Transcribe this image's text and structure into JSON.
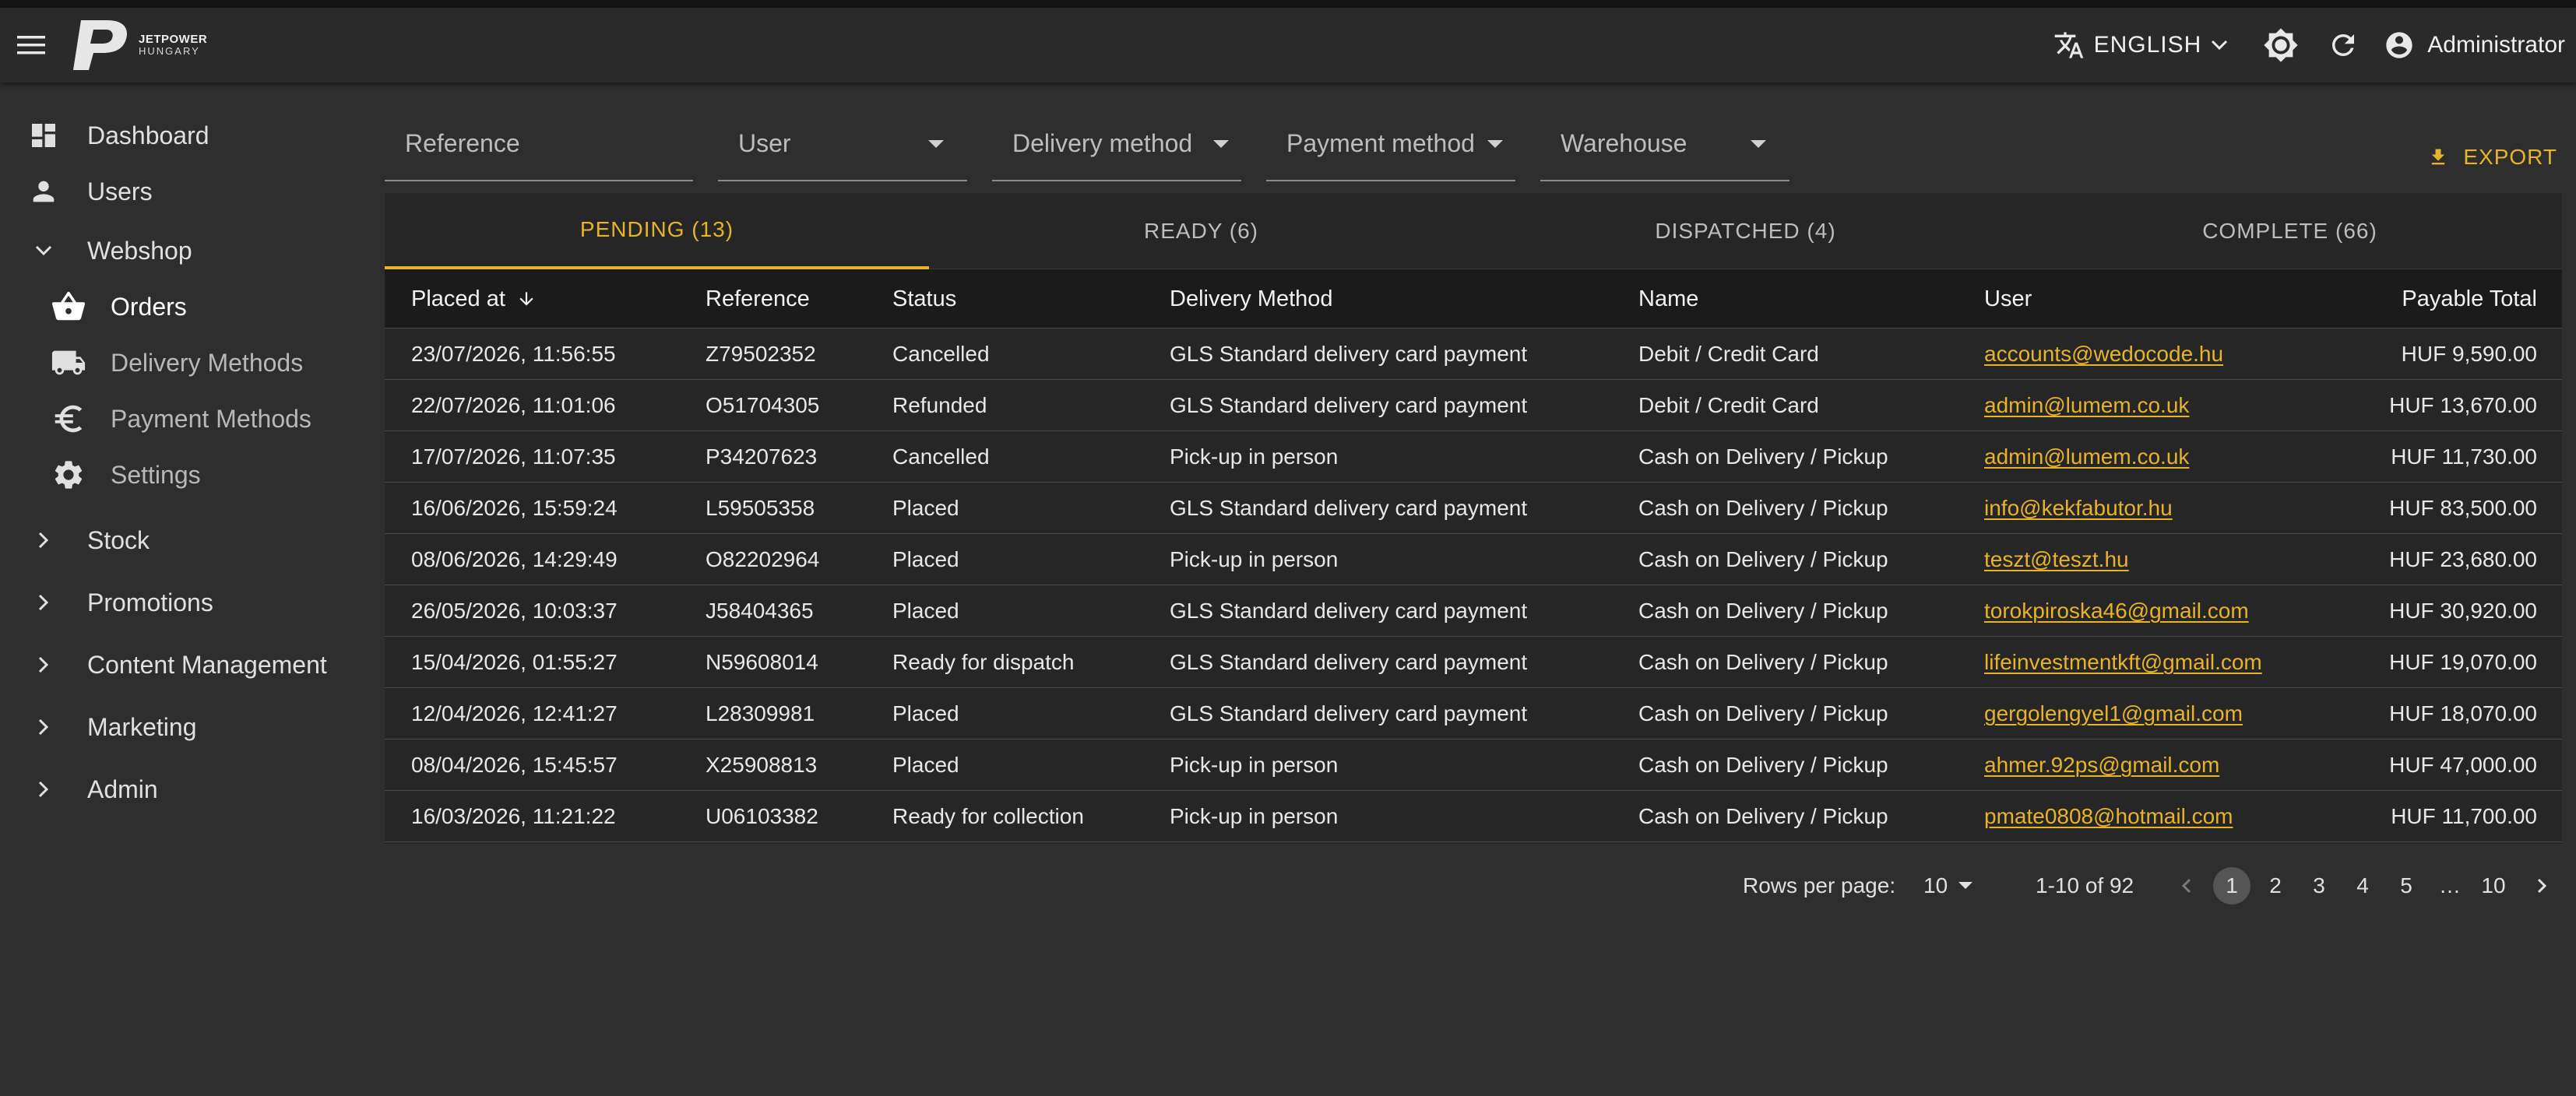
{
  "app": {
    "logo_line1": "JETPOWER",
    "logo_line2": "HUNGARY",
    "language": "ENGLISH",
    "user": "Administrator"
  },
  "sidebar": {
    "dashboard": "Dashboard",
    "users": "Users",
    "webshop": "Webshop",
    "orders": "Orders",
    "delivery_methods": "Delivery Methods",
    "payment_methods": "Payment Methods",
    "settings": "Settings",
    "stock": "Stock",
    "promotions": "Promotions",
    "content_management": "Content Management",
    "marketing": "Marketing",
    "admin": "Admin"
  },
  "filters": {
    "reference": "Reference",
    "user": "User",
    "delivery_method": "Delivery method",
    "payment_method": "Payment method",
    "warehouse": "Warehouse"
  },
  "export_label": "EXPORT",
  "tabs": [
    "PENDING (13)",
    "READY (6)",
    "DISPATCHED (4)",
    "COMPLETE (66)"
  ],
  "columns": {
    "placed_at": "Placed at",
    "reference": "Reference",
    "status": "Status",
    "delivery_method": "Delivery Method",
    "name": "Name",
    "user": "User",
    "payable_total": "Payable Total"
  },
  "rows": [
    {
      "placed_at": "23/07/2026, 11:56:55",
      "reference": "Z79502352",
      "status": "Cancelled",
      "delivery": "GLS Standard delivery card payment",
      "name": "Debit / Credit Card",
      "user": "accounts@wedocode.hu",
      "total": "HUF 9,590.00"
    },
    {
      "placed_at": "22/07/2026, 11:01:06",
      "reference": "O51704305",
      "status": "Refunded",
      "delivery": "GLS Standard delivery card payment",
      "name": "Debit / Credit Card",
      "user": "admin@lumem.co.uk",
      "total": "HUF 13,670.00"
    },
    {
      "placed_at": "17/07/2026, 11:07:35",
      "reference": "P34207623",
      "status": "Cancelled",
      "delivery": "Pick-up in person",
      "name": "Cash on Delivery / Pickup",
      "user": "admin@lumem.co.uk",
      "total": "HUF 11,730.00"
    },
    {
      "placed_at": "16/06/2026, 15:59:24",
      "reference": "L59505358",
      "status": "Placed",
      "delivery": "GLS Standard delivery card payment",
      "name": "Cash on Delivery / Pickup",
      "user": "info@kekfabutor.hu",
      "total": "HUF 83,500.00"
    },
    {
      "placed_at": "08/06/2026, 14:29:49",
      "reference": "O82202964",
      "status": "Placed",
      "delivery": "Pick-up in person",
      "name": "Cash on Delivery / Pickup",
      "user": "teszt@teszt.hu",
      "total": "HUF 23,680.00"
    },
    {
      "placed_at": "26/05/2026, 10:03:37",
      "reference": "J58404365",
      "status": "Placed",
      "delivery": "GLS Standard delivery card payment",
      "name": "Cash on Delivery / Pickup",
      "user": "torokpiroska46@gmail.com",
      "total": "HUF 30,920.00"
    },
    {
      "placed_at": "15/04/2026, 01:55:27",
      "reference": "N59608014",
      "status": "Ready for dispatch",
      "delivery": "GLS Standard delivery card payment",
      "name": "Cash on Delivery / Pickup",
      "user": "lifeinvestmentkft@gmail.com",
      "total": "HUF 19,070.00"
    },
    {
      "placed_at": "12/04/2026, 12:41:27",
      "reference": "L28309981",
      "status": "Placed",
      "delivery": "GLS Standard delivery card payment",
      "name": "Cash on Delivery / Pickup",
      "user": "gergolengyel1@gmail.com",
      "total": "HUF 18,070.00"
    },
    {
      "placed_at": "08/04/2026, 15:45:57",
      "reference": "X25908813",
      "status": "Placed",
      "delivery": "Pick-up in person",
      "name": "Cash on Delivery / Pickup",
      "user": "ahmer.92ps@gmail.com",
      "total": "HUF 47,000.00"
    },
    {
      "placed_at": "16/03/2026, 11:21:22",
      "reference": "U06103382",
      "status": "Ready for collection",
      "delivery": "Pick-up in person",
      "name": "Cash on Delivery / Pickup",
      "user": "pmate0808@hotmail.com",
      "total": "HUF 11,700.00"
    }
  ],
  "pagination": {
    "rows_per_page_label": "Rows per page:",
    "rows_per_page": "10",
    "range": "1-10 of 92",
    "pages": [
      "1",
      "2",
      "3",
      "4",
      "5",
      "…",
      "10"
    ]
  },
  "colors": {
    "accent": "#e7b32a",
    "background": "#2e2e2e",
    "appbar": "#2a2a2a"
  }
}
